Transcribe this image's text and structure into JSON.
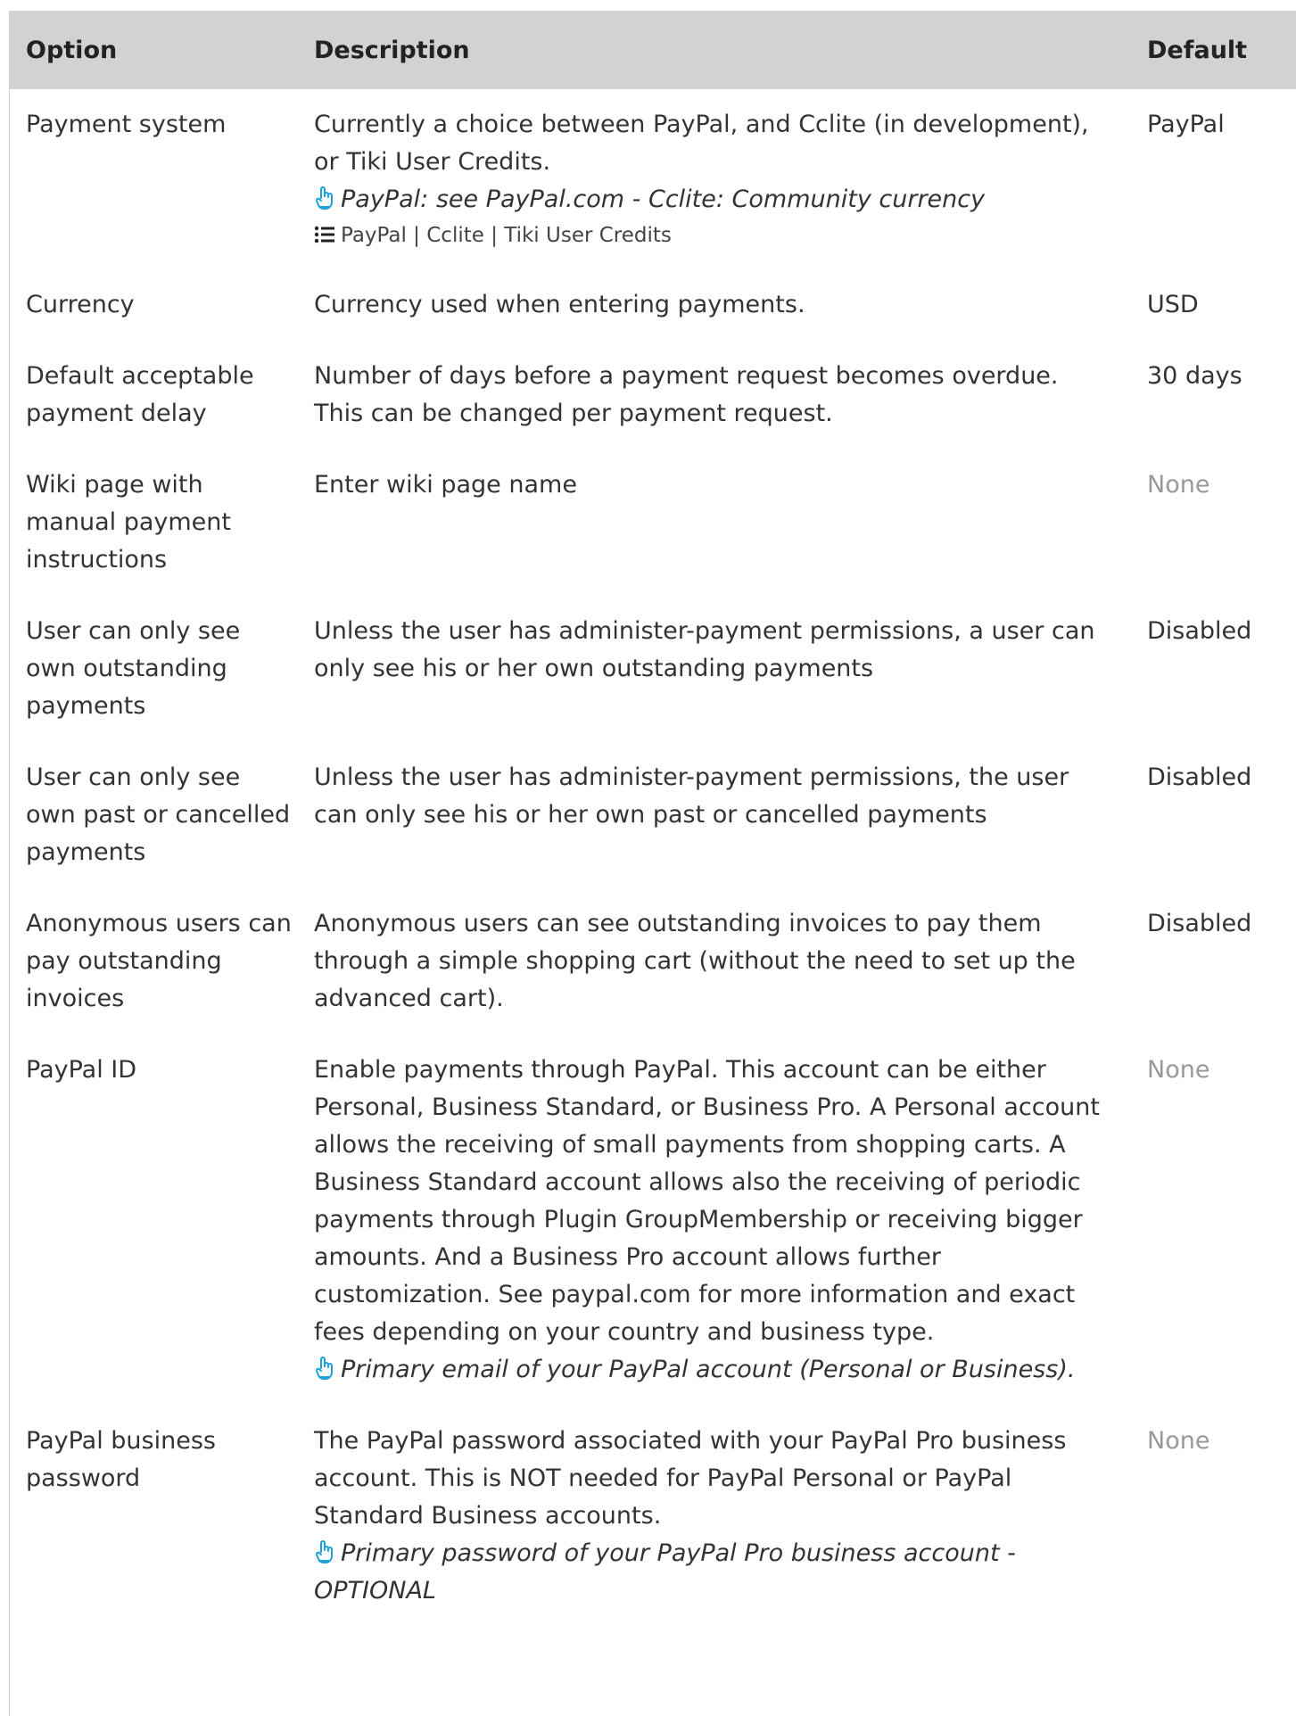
{
  "header": {
    "option": "Option",
    "description": "Description",
    "default": "Default"
  },
  "rows": [
    {
      "option": "Payment system",
      "description": "Currently a choice between PayPal, and Cclite (in development), or Tiki User Credits.",
      "hint": "PayPal: see PayPal.com - Cclite: Community currency",
      "choices": "PayPal | Cclite | Tiki User Credits",
      "default": "PayPal"
    },
    {
      "option": "Currency",
      "description": "Currency used when entering payments.",
      "default": "USD"
    },
    {
      "option": "Default acceptable payment delay",
      "description": "Number of days before a payment request becomes overdue. This can be changed per payment request.",
      "default": "30 days"
    },
    {
      "option": "Wiki page with manual payment instructions",
      "description": "Enter wiki page name",
      "default": "None"
    },
    {
      "option": "User can only see own outstanding payments",
      "description": "Unless the user has administer-payment permissions, a user can only see his or her own outstanding payments",
      "default": "Disabled"
    },
    {
      "option": "User can only see own past or cancelled payments",
      "description": "Unless the user has administer-payment permissions, the user can only see his or her own past or cancelled payments",
      "default": "Disabled"
    },
    {
      "option": "Anonymous users can pay outstanding invoices",
      "description": "Anonymous users can see outstanding invoices to pay them through a simple shopping cart (without the need to set up the advanced cart).",
      "default": "Disabled"
    },
    {
      "option": "PayPal ID",
      "description": "Enable payments through PayPal. This account can be either Personal, Business Standard, or Business Pro. A Personal account allows the receiving of small payments from shopping carts. A Business Standard account allows also the receiving of periodic payments through Plugin GroupMembership or receiving bigger amounts. And a Business Pro account allows further customization. See paypal.com for more information and exact fees depending on your country and business type.",
      "hint": "Primary email of your PayPal account (Personal or Business).",
      "default": "None"
    },
    {
      "option": "PayPal business password",
      "description": "The PayPal password associated with your PayPal Pro business account. This is NOT needed for PayPal Personal or PayPal Standard Business accounts.",
      "hint": "Primary password of your PayPal Pro business account - OPTIONAL",
      "default": "None"
    }
  ],
  "colors": {
    "header_bg": "#d2d2d2",
    "text": "#333333",
    "muted": "#999999",
    "hint_icon": "#1aa3d9"
  },
  "icons": {
    "hint": "hand-pointer-icon",
    "choices": "list-icon"
  }
}
